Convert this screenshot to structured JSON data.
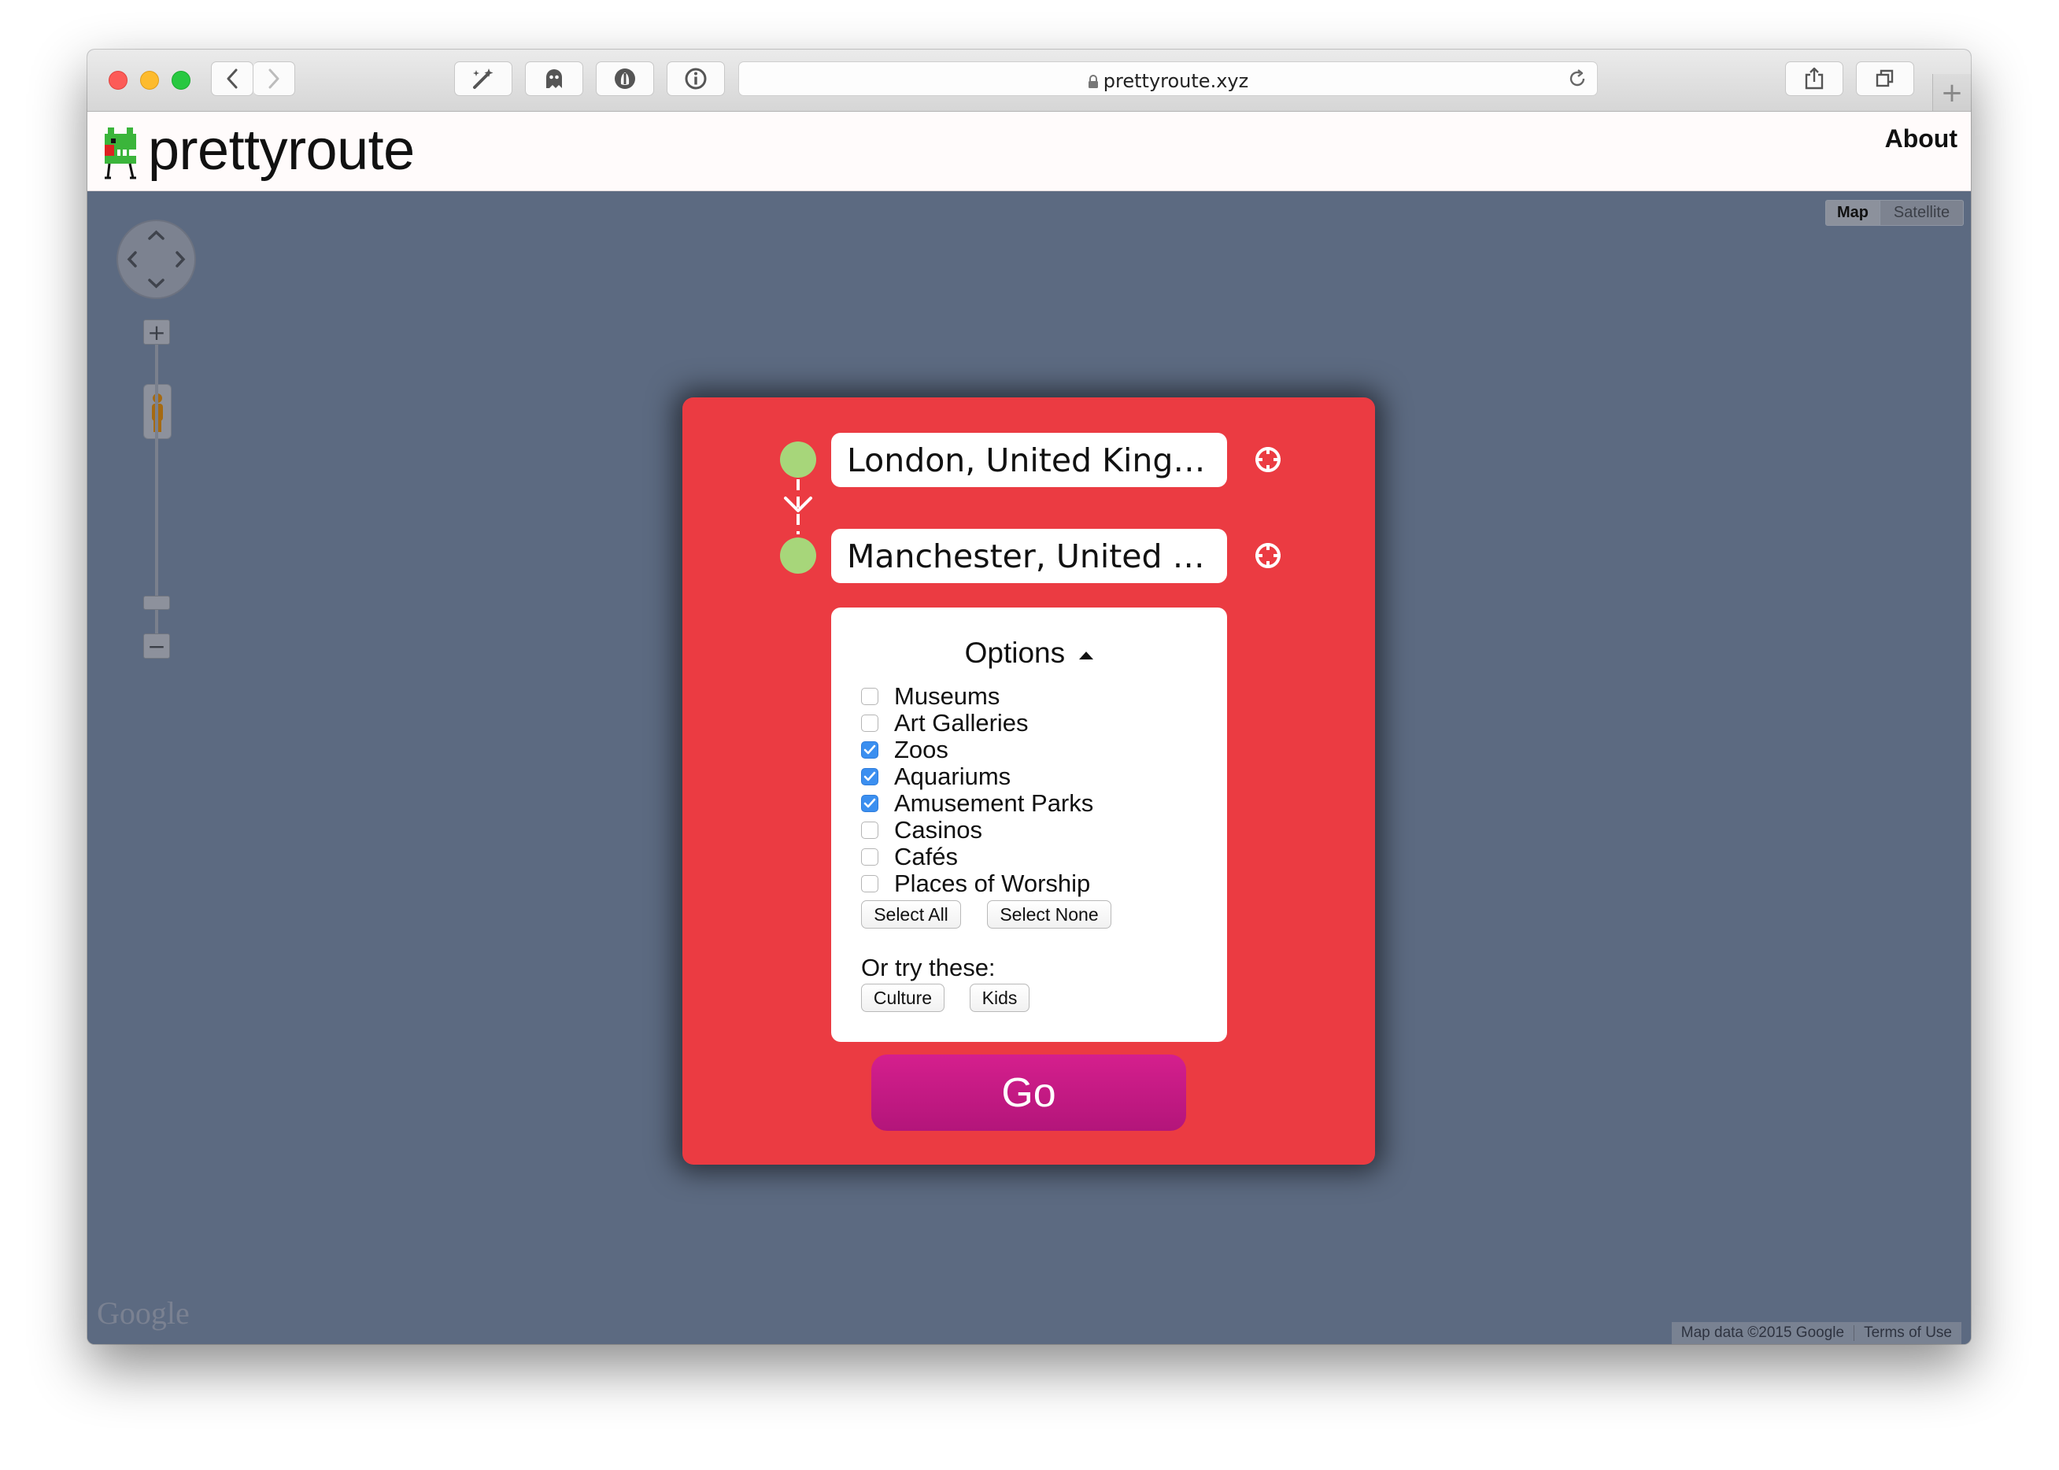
{
  "browser": {
    "url": "prettyroute.xyz",
    "traffic_lights": [
      "#fc5b57",
      "#fdbb2e",
      "#27c840"
    ],
    "icons": [
      "back-icon",
      "forward-icon",
      "magic-wand-icon",
      "ghost-icon",
      "privacy-badger-icon",
      "info-icon",
      "lock-icon",
      "reload-icon",
      "share-icon",
      "tabs-icon",
      "new-tab-icon"
    ]
  },
  "header": {
    "logo_text": "prettyroute",
    "about_label": "About"
  },
  "map": {
    "type_map_label": "Map",
    "type_satellite_label": "Satellite",
    "google_logo": "Google",
    "attribution": "Map data ©2015 Google",
    "terms": "Terms of Use",
    "zoom_in": "+",
    "zoom_out": "−"
  },
  "route": {
    "origin": "London, United Kingdom",
    "destination": "Manchester, United Kingdom",
    "dot_color": "#a7d67a",
    "card_color": "#eb3b42"
  },
  "options": {
    "title": "Options",
    "items": [
      {
        "label": "Museums",
        "checked": false
      },
      {
        "label": "Art Galleries",
        "checked": false
      },
      {
        "label": "Zoos",
        "checked": true
      },
      {
        "label": "Aquariums",
        "checked": true
      },
      {
        "label": "Amusement Parks",
        "checked": true
      },
      {
        "label": "Casinos",
        "checked": false
      },
      {
        "label": "Cafés",
        "checked": false
      },
      {
        "label": "Places of Worship",
        "checked": false
      }
    ],
    "select_all_label": "Select All",
    "select_none_label": "Select None",
    "try_label": "Or try these:",
    "presets": [
      "Culture",
      "Kids"
    ]
  },
  "go_label": "Go",
  "go_color": "#c81b86"
}
